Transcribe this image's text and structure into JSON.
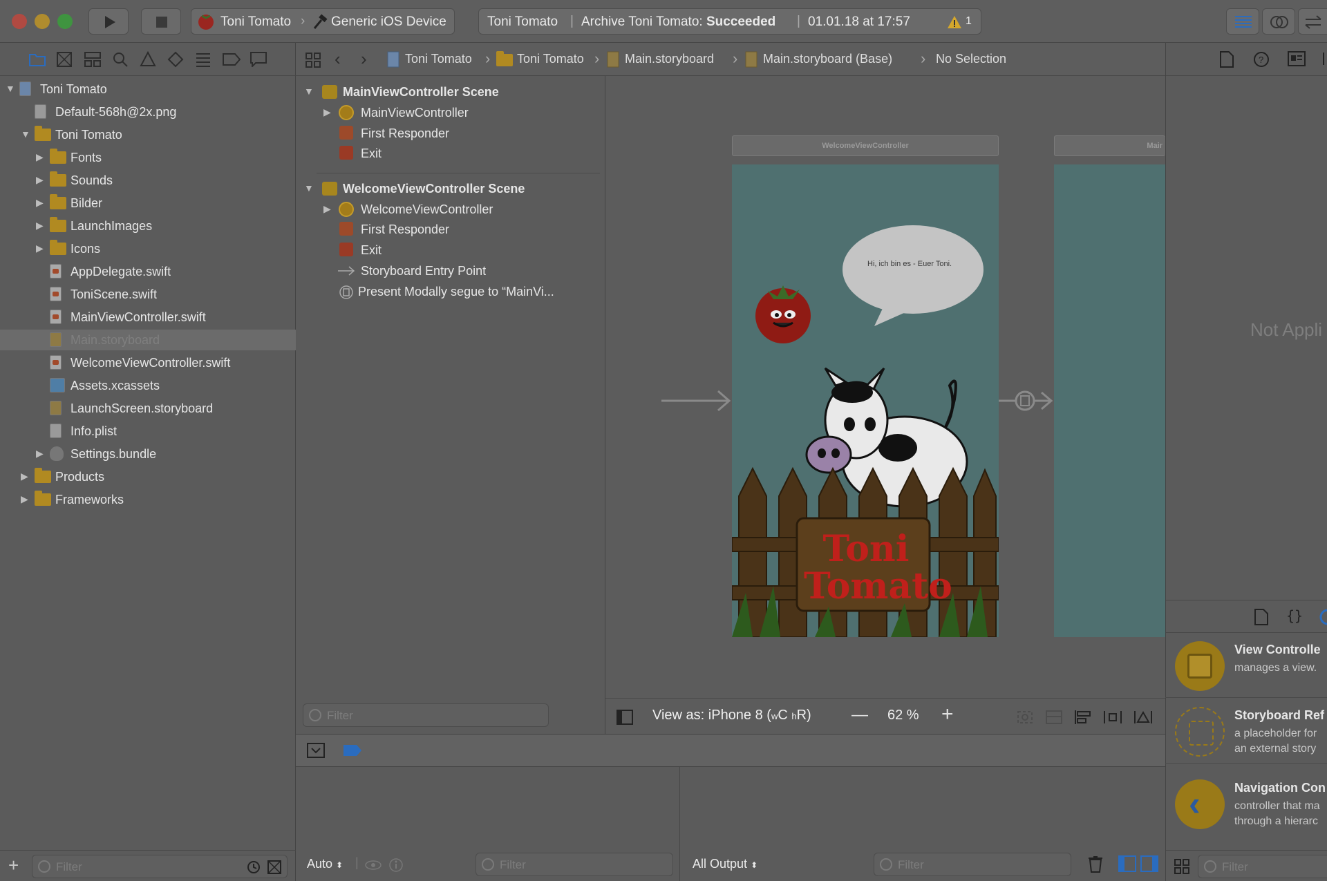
{
  "toolbar": {
    "scheme_target": "Toni Tomato",
    "scheme_device": "Generic iOS Device",
    "activity_project": "Toni Tomato",
    "activity_status_prefix": "Archive Toni Tomato: ",
    "activity_status_bold": "Succeeded",
    "activity_time": "01.01.18 at 17:57",
    "warning_count": "1"
  },
  "navigator": {
    "items": [
      {
        "label": "Toni Tomato",
        "depth": 0,
        "kind": "project",
        "disclosure": "open"
      },
      {
        "label": "Default-568h@2x.png",
        "depth": 1,
        "kind": "image"
      },
      {
        "label": "Toni Tomato",
        "depth": 1,
        "kind": "folder",
        "disclosure": "open"
      },
      {
        "label": "Fonts",
        "depth": 2,
        "kind": "folder",
        "disclosure": "closed"
      },
      {
        "label": "Sounds",
        "depth": 2,
        "kind": "folder",
        "disclosure": "closed"
      },
      {
        "label": "Bilder",
        "depth": 2,
        "kind": "folder",
        "disclosure": "closed"
      },
      {
        "label": "LaunchImages",
        "depth": 2,
        "kind": "folder",
        "disclosure": "closed"
      },
      {
        "label": "Icons",
        "depth": 2,
        "kind": "folder",
        "disclosure": "closed"
      },
      {
        "label": "AppDelegate.swift",
        "depth": 2,
        "kind": "swift"
      },
      {
        "label": "ToniScene.swift",
        "depth": 2,
        "kind": "swift"
      },
      {
        "label": "MainViewController.swift",
        "depth": 2,
        "kind": "swift"
      },
      {
        "label": "Main.storyboard",
        "depth": 2,
        "kind": "storyboard",
        "selected": true
      },
      {
        "label": "WelcomeViewController.swift",
        "depth": 2,
        "kind": "swift"
      },
      {
        "label": "Assets.xcassets",
        "depth": 2,
        "kind": "assets"
      },
      {
        "label": "LaunchScreen.storyboard",
        "depth": 2,
        "kind": "storyboard"
      },
      {
        "label": "Info.plist",
        "depth": 2,
        "kind": "plist"
      },
      {
        "label": "Settings.bundle",
        "depth": 2,
        "kind": "bundle",
        "disclosure": "closed"
      },
      {
        "label": "Products",
        "depth": 1,
        "kind": "folder",
        "disclosure": "closed"
      },
      {
        "label": "Frameworks",
        "depth": 1,
        "kind": "folder",
        "disclosure": "closed"
      }
    ],
    "filter_placeholder": "Filter"
  },
  "jumpbar": {
    "crumbs": [
      "Toni Tomato",
      "Toni Tomato",
      "Main.storyboard",
      "Main.storyboard (Base)",
      "No Selection"
    ]
  },
  "outline": {
    "scenes": [
      {
        "title": "MainViewController Scene",
        "children": [
          "MainViewController",
          "First Responder",
          "Exit"
        ]
      },
      {
        "title": "WelcomeViewController Scene",
        "children": [
          "WelcomeViewController",
          "First Responder",
          "Exit",
          "Storyboard Entry Point",
          "Present Modally segue to “MainVi..."
        ]
      }
    ],
    "filter_placeholder": "Filter"
  },
  "canvas": {
    "scene1_title": "WelcomeViewController",
    "scene2_title": "Mair",
    "speech_text": "Hi, ich bin es - Euer Toni.",
    "sign_text": "Toni Tomato",
    "view_as": "View as: iPhone 8 (",
    "view_as_w": "w",
    "view_as_c": "C ",
    "view_as_h": "h",
    "view_as_r": "R)",
    "zoom": "62 %"
  },
  "debug": {
    "auto_label": "Auto",
    "filter_placeholder": "Filter",
    "output_label": "All Output",
    "filter2_placeholder": "Filter"
  },
  "inspector": {
    "not_applicable": "Not Appli",
    "library": [
      {
        "title": "View Controlle",
        "desc": "manages a view."
      },
      {
        "title": "Storyboard Ref",
        "desc": "a placeholder for\nan external story"
      },
      {
        "title": "Navigation Con",
        "desc": "controller that ma\nthrough a hierarc"
      }
    ],
    "filter_placeholder": "Filter"
  },
  "colors": {
    "accent_blue": "#2a6cbf",
    "folder": "#b18a21",
    "canvas_scene": "#4f7070",
    "warning": "#d4a72c",
    "sign_text": "#c0201b"
  }
}
